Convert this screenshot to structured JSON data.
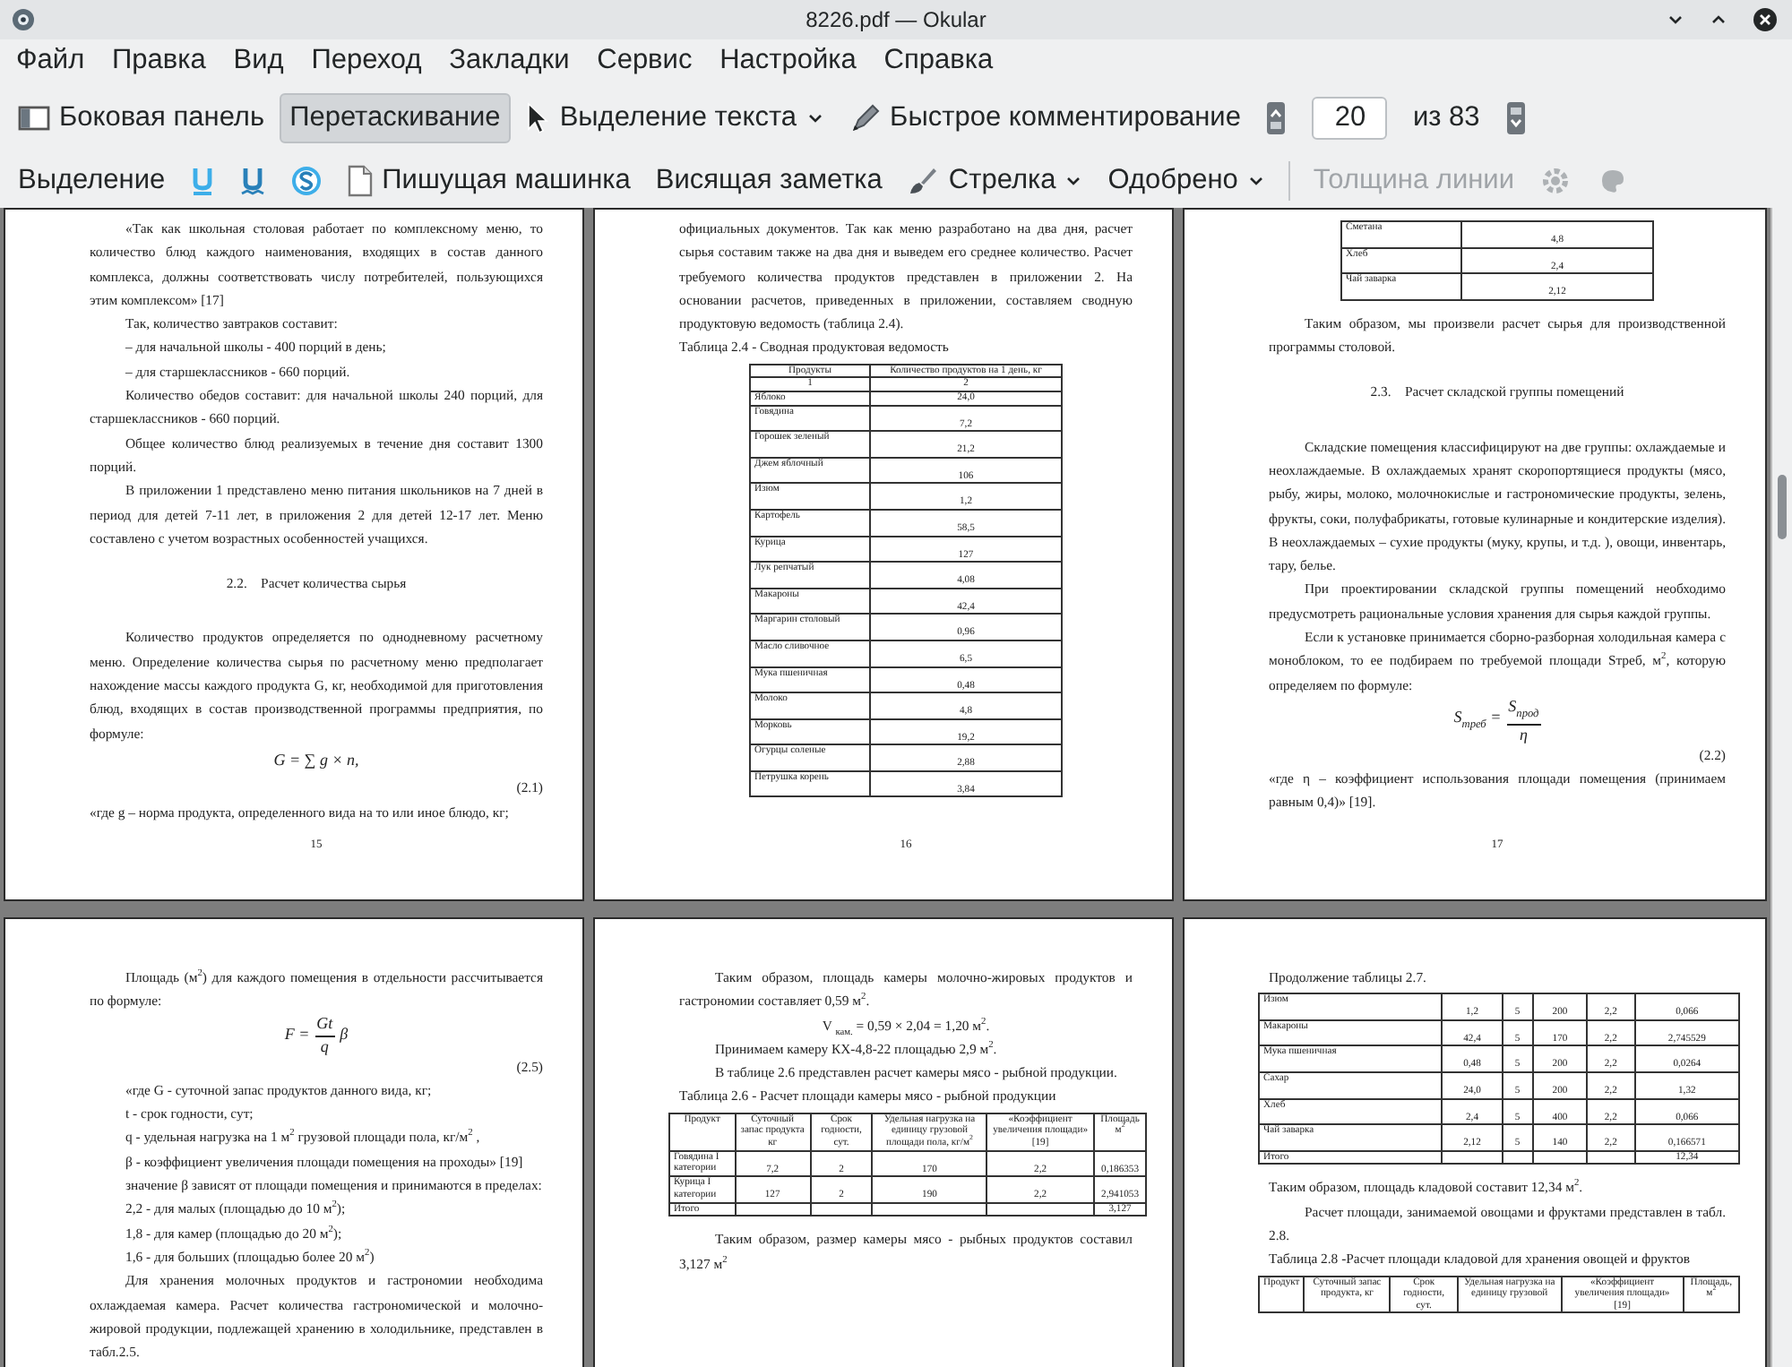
{
  "window": {
    "title": "8226.pdf — Okular"
  },
  "menu": [
    "Файл",
    "Правка",
    "Вид",
    "Переход",
    "Закладки",
    "Сервис",
    "Настройка",
    "Справка"
  ],
  "toolbar_main": [
    {
      "kind": "button",
      "label": "Боковая панель",
      "selected": false
    },
    {
      "kind": "button",
      "label": "Перетаскивание",
      "selected": true
    },
    {
      "kind": "menu-button",
      "label": "Выделение текста",
      "selected": false
    },
    {
      "kind": "button",
      "label": "Быстрое комментирование",
      "selected": false
    },
    {
      "kind": "icon-button",
      "selected": false
    },
    {
      "kind": "field",
      "value": "20"
    },
    {
      "kind": "text",
      "label": "из 83"
    },
    {
      "kind": "icon-button",
      "selected": false
    }
  ],
  "toolbar_annotations": [
    {
      "kind": "button",
      "label": "Выделение",
      "disabled": false
    },
    {
      "kind": "icon-button",
      "disabled": false
    },
    {
      "kind": "icon-button",
      "disabled": false
    },
    {
      "kind": "icon-button",
      "disabled": false
    },
    {
      "kind": "button",
      "label": "Пишущая машинка",
      "disabled": false
    },
    {
      "kind": "button",
      "label": "Висящая заметка",
      "disabled": false
    },
    {
      "kind": "menu-button",
      "label": "Стрелка",
      "disabled": false
    },
    {
      "kind": "menu-button",
      "label": "Одобрено",
      "disabled": false
    },
    {
      "kind": "separator"
    },
    {
      "kind": "button",
      "label": "Толщина линии",
      "disabled": true
    },
    {
      "kind": "icon-button",
      "disabled": true
    },
    {
      "kind": "icon-button",
      "disabled": true
    }
  ],
  "pages": [
    {
      "blocks": [
        {
          "kind": "paragraph",
          "text": "«Так как школьная столовая работает по комплексному меню, то количество блюд каждого наименования, входящих в состав данного комплекса, должны соответствовать числу потребителей, пользующихся этим комплексом» [17]"
        },
        {
          "kind": "paragraph",
          "text": "Так, количество завтраков составит:"
        },
        {
          "kind": "paragraph",
          "text": "– для начальной школы - 400 порций в день;"
        },
        {
          "kind": "paragraph",
          "text": "– для старшеклассников - 660 порций."
        },
        {
          "kind": "paragraph",
          "text": "Количество обедов составит: для начальной школы 240 порций,  для старшеклассников - 660 порций."
        },
        {
          "kind": "paragraph",
          "text": "Общее количество блюд реализуемых в течение дня составит 1300 порций."
        },
        {
          "kind": "paragraph",
          "text": "В приложении 1 представлено меню питания школьников на 7 дней в период для детей 7-11 лет, в приложения 2 для детей 12-17 лет. Меню составлено с учетом возрастных особенностей учащихся."
        },
        {
          "kind": "heading",
          "text": "2.2.    Расчет количества сырья"
        },
        {
          "kind": "paragraph",
          "text": "Количество продуктов определяется по однодневному расчетному меню. Определение количества сырья по расчетному меню предполагает нахождение массы каждого продукта G, кг, необходимой для приготовления блюд, входящих в состав производственной программы предприятия, по формуле:"
        },
        {
          "kind": "formula",
          "text": "G = ∑ g × n,"
        },
        {
          "kind": "equation-number",
          "text": "(2.1)"
        },
        {
          "kind": "plain",
          "text": "«где g – норма продукта, определенного вида на то или иное блюдо, кг;"
        },
        {
          "kind": "page-number",
          "text": "15"
        }
      ]
    },
    {
      "blocks": [
        {
          "kind": "plain",
          "text": "официальных документов. Так как меню разработано на два дня, расчет сырья составим также на два дня и выведем его среднее количество. Расчет требуемого количества продуктов представлен в приложении 2. На основании расчетов, приведенных в приложении, составляем сводную продуктовую ведомость (таблица 2.4)."
        },
        {
          "kind": "caption",
          "text": "Таблица 2.4 - Сводная продуктовая ведомость"
        },
        {
          "kind": "table",
          "rows": [
            {
              "kind": "header",
              "cells": [
                "Продукты",
                "Количество продуктов на 1 день, кг"
              ]
            },
            {
              "kind": "numbering",
              "cells": [
                "1",
                "2"
              ]
            },
            {
              "kind": "single",
              "cells": [
                "Яблоко",
                "24,0"
              ]
            },
            {
              "kind": "tall",
              "cells": [
                "Говядина",
                "7,2"
              ]
            },
            {
              "kind": "tall",
              "cells": [
                "Горошек зеленый",
                "21,2"
              ]
            },
            {
              "kind": "tall",
              "cells": [
                "Джем яблочный",
                "106"
              ]
            },
            {
              "kind": "tall",
              "cells": [
                "Изюм",
                "1,2"
              ]
            },
            {
              "kind": "tall",
              "cells": [
                "Картофель",
                "58,5"
              ]
            },
            {
              "kind": "tall",
              "cells": [
                "Курица",
                "127"
              ]
            },
            {
              "kind": "tall",
              "cells": [
                "Лук репчатый",
                "4,08"
              ]
            },
            {
              "kind": "tall",
              "cells": [
                "Макароны",
                "42,4"
              ]
            },
            {
              "kind": "tall",
              "cells": [
                "Маргарин столовый",
                "0,96"
              ]
            },
            {
              "kind": "tall",
              "cells": [
                "Масло сливочное",
                "6,5"
              ]
            },
            {
              "kind": "tall",
              "cells": [
                "Мука пшеничная",
                "0,48"
              ]
            },
            {
              "kind": "tall",
              "cells": [
                "Молоко",
                "4,8"
              ]
            },
            {
              "kind": "tall",
              "cells": [
                "Морковь",
                "19,2"
              ]
            },
            {
              "kind": "tall",
              "cells": [
                "Огурцы соленые",
                "2,88"
              ]
            },
            {
              "kind": "tall",
              "cells": [
                "Петрушка корень",
                "3,84"
              ]
            }
          ]
        },
        {
          "kind": "page-number",
          "text": "16"
        }
      ]
    },
    {
      "blocks": [
        {
          "kind": "table",
          "rows": [
            {
              "kind": "tall",
              "cells": [
                "Сметана",
                "4,8"
              ]
            },
            {
              "kind": "tall",
              "cells": [
                "Хлеб",
                "2,4"
              ]
            },
            {
              "kind": "tall",
              "cells": [
                "Чай заварка",
                "2,12"
              ]
            }
          ]
        },
        {
          "kind": "paragraph",
          "text": "Таким образом, мы произвели расчет сырья для производственной программы столовой."
        },
        {
          "kind": "heading",
          "text": "2.3.    Расчет складской группы помещений"
        },
        {
          "kind": "paragraph",
          "text": "Складские помещения классифицируют на две группы: охлаждаемые и неохлаждаемые. В охлаждаемых хранят скоропортящиеся продукты (мясо, рыбу, жиры, молоко, молочнокислые и гастрономические продукты, зелень, фрукты, соки, полуфабрикаты, готовые кулинарные и кондитерские изделия). В неохлаждаемых – сухие продукты (муку, крупы, и т.д. ), овощи, инвентарь, тару, белье."
        },
        {
          "kind": "paragraph",
          "text": "При проектировании складской группы помещений необходимо предусмотреть рациональные условия хранения для сырья каждой группы."
        },
        {
          "kind": "paragraph",
          "text": "Если к установке принимается сборно-разборная холодильная камера с моноблоком, то ее подбираем по требуемой площади Sтреб, м$^{2}$, которую определяем по формуле:"
        },
        {
          "kind": "fraction",
          "left": "S$_{треб}$ =",
          "numerator": "S$_{прод}$",
          "denominator": "η"
        },
        {
          "kind": "equation-number",
          "text": "(2.2)"
        },
        {
          "kind": "plain",
          "text": "«где η – коэффициент использования площади помещения (принимаем равным 0,4)» [19]."
        },
        {
          "kind": "page-number",
          "text": "17"
        }
      ]
    },
    {
      "blocks": [
        {
          "kind": "paragraph",
          "text": "Площадь (м$^{2}$) для каждого помещения в отдельности рассчитывается по формуле:"
        },
        {
          "kind": "fraction",
          "left": "F =",
          "numerator": "Gt",
          "denominator": "q",
          "right": "β"
        },
        {
          "kind": "equation-number",
          "text": "(2.5)"
        },
        {
          "kind": "paragraph",
          "text": "«где G - суточной запас продуктов данного вида, кг;"
        },
        {
          "kind": "paragraph",
          "text": "t - срок годности, сут;"
        },
        {
          "kind": "paragraph",
          "text": "q - удельная нагрузка на 1 м$^{2}$ грузовой площади пола, кг/м$^{2}$ ,"
        },
        {
          "kind": "paragraph",
          "text": "β - коэффициент увеличения площади помещения на проходы» [19]"
        },
        {
          "kind": "paragraph",
          "text": "значение β зависят от площади помещения и принимаются в пределах:"
        },
        {
          "kind": "paragraph",
          "text": "2,2 - для малых (площадью до 10 м$^{2}$);"
        },
        {
          "kind": "paragraph",
          "text": "1,8 - для камер (площадью до 20 м$^{2}$);"
        },
        {
          "kind": "paragraph",
          "text": "1,6 - для больших (площадью более 20 м$^{2}$)"
        },
        {
          "kind": "paragraph",
          "text": "Для хранения молочных продуктов и гастрономии необходима охлаждаемая камера. Расчет количества гастрономической и молочно-жировой продукции, подлежащей хранению в холодильнике, представлен в табл.2.5."
        }
      ]
    },
    {
      "blocks": [
        {
          "kind": "paragraph",
          "text": "Таким образом, площадь камеры молочно-жировых продуктов и гастрономии составляет 0,59 м$^{2}$."
        },
        {
          "kind": "centered",
          "text": "V $_{кам.}$ =  0,59 × 2,04 = 1,20  м$^{2}$."
        },
        {
          "kind": "paragraph",
          "text": "Принимаем  камеру КХ-4,8-22 площадью  2,9 м$^{2}$."
        },
        {
          "kind": "paragraph",
          "text": "В таблице 2.6 представлен расчет камеры мясо - рыбной продукции."
        },
        {
          "kind": "caption",
          "text": "Таблица 2.6 - Расчет площади камеры мясо - рыбной продукции"
        },
        {
          "kind": "table",
          "rows": [
            {
              "kind": "header",
              "cells": [
                "Продукт",
                "Суточный запас продукта кг",
                "Срок годности, сут.",
                "Удельная нагрузка на единицу грузовой площади пола, кг/м$^{2}$",
                "«Коэффициент увеличения площади» [19]",
                "Площадь м$^{2}$"
              ]
            },
            {
              "kind": "tall",
              "cells": [
                "Говядина I категории",
                "7,2",
                "2",
                "170",
                "2,2",
                "0,186353"
              ]
            },
            {
              "kind": "tall",
              "cells": [
                "Курица I категории",
                "127",
                "2",
                "190",
                "2,2",
                "2,941053"
              ]
            },
            {
              "kind": "total",
              "cells": [
                "Итого",
                null,
                null,
                null,
                null,
                "3,127"
              ]
            }
          ]
        },
        {
          "kind": "paragraph",
          "text": "Таким образом, размер камеры мясо - рыбных продуктов составил 3,127 м$^{2}$"
        }
      ]
    },
    {
      "blocks": [
        {
          "kind": "plain",
          "text": "Продолжение таблицы 2.7."
        },
        {
          "kind": "table",
          "rows": [
            {
              "kind": "tall",
              "cells": [
                "Изюм",
                "1,2",
                "5",
                "200",
                "2,2",
                "0,066"
              ]
            },
            {
              "kind": "tall",
              "cells": [
                "Макароны",
                "42,4",
                "5",
                "170",
                "2,2",
                "2,745529"
              ]
            },
            {
              "kind": "tall",
              "cells": [
                "Мука пшеничная",
                "0,48",
                "5",
                "200",
                "2,2",
                "0,0264"
              ]
            },
            {
              "kind": "tall",
              "cells": [
                "Сахар",
                "24,0",
                "5",
                "200",
                "2,2",
                "1,32"
              ]
            },
            {
              "kind": "tall",
              "cells": [
                "Хлеб",
                "2,4",
                "5",
                "400",
                "2,2",
                "0,066"
              ]
            },
            {
              "kind": "tall",
              "cells": [
                "Чай заварка",
                "2,12",
                "5",
                "140",
                "2,2",
                "0,166571"
              ]
            },
            {
              "kind": "total",
              "cells": [
                "Итого",
                null,
                null,
                null,
                null,
                "12,34"
              ]
            }
          ]
        },
        {
          "kind": "plain",
          "text": "Таким образом, площадь кладовой составит 12,34 м$^{2}$."
        },
        {
          "kind": "paragraph",
          "text": "Расчет площади, занимаемой овощами  и фруктами  представлен в табл. 2.8."
        },
        {
          "kind": "caption",
          "text": "Таблица 2.8 -Расчет площади кладовой для хранения овощей и фруктов"
        },
        {
          "kind": "table",
          "rows": [
            {
              "kind": "header",
              "cells": [
                "Продукт",
                "Суточный запас продукта, кг",
                "Срок годности, сут.",
                "Удельная нагрузка на единицу грузовой",
                "«Коэффициент увеличения площади» [19]",
                "Площадь, м$^{2}$"
              ]
            }
          ]
        }
      ]
    }
  ]
}
